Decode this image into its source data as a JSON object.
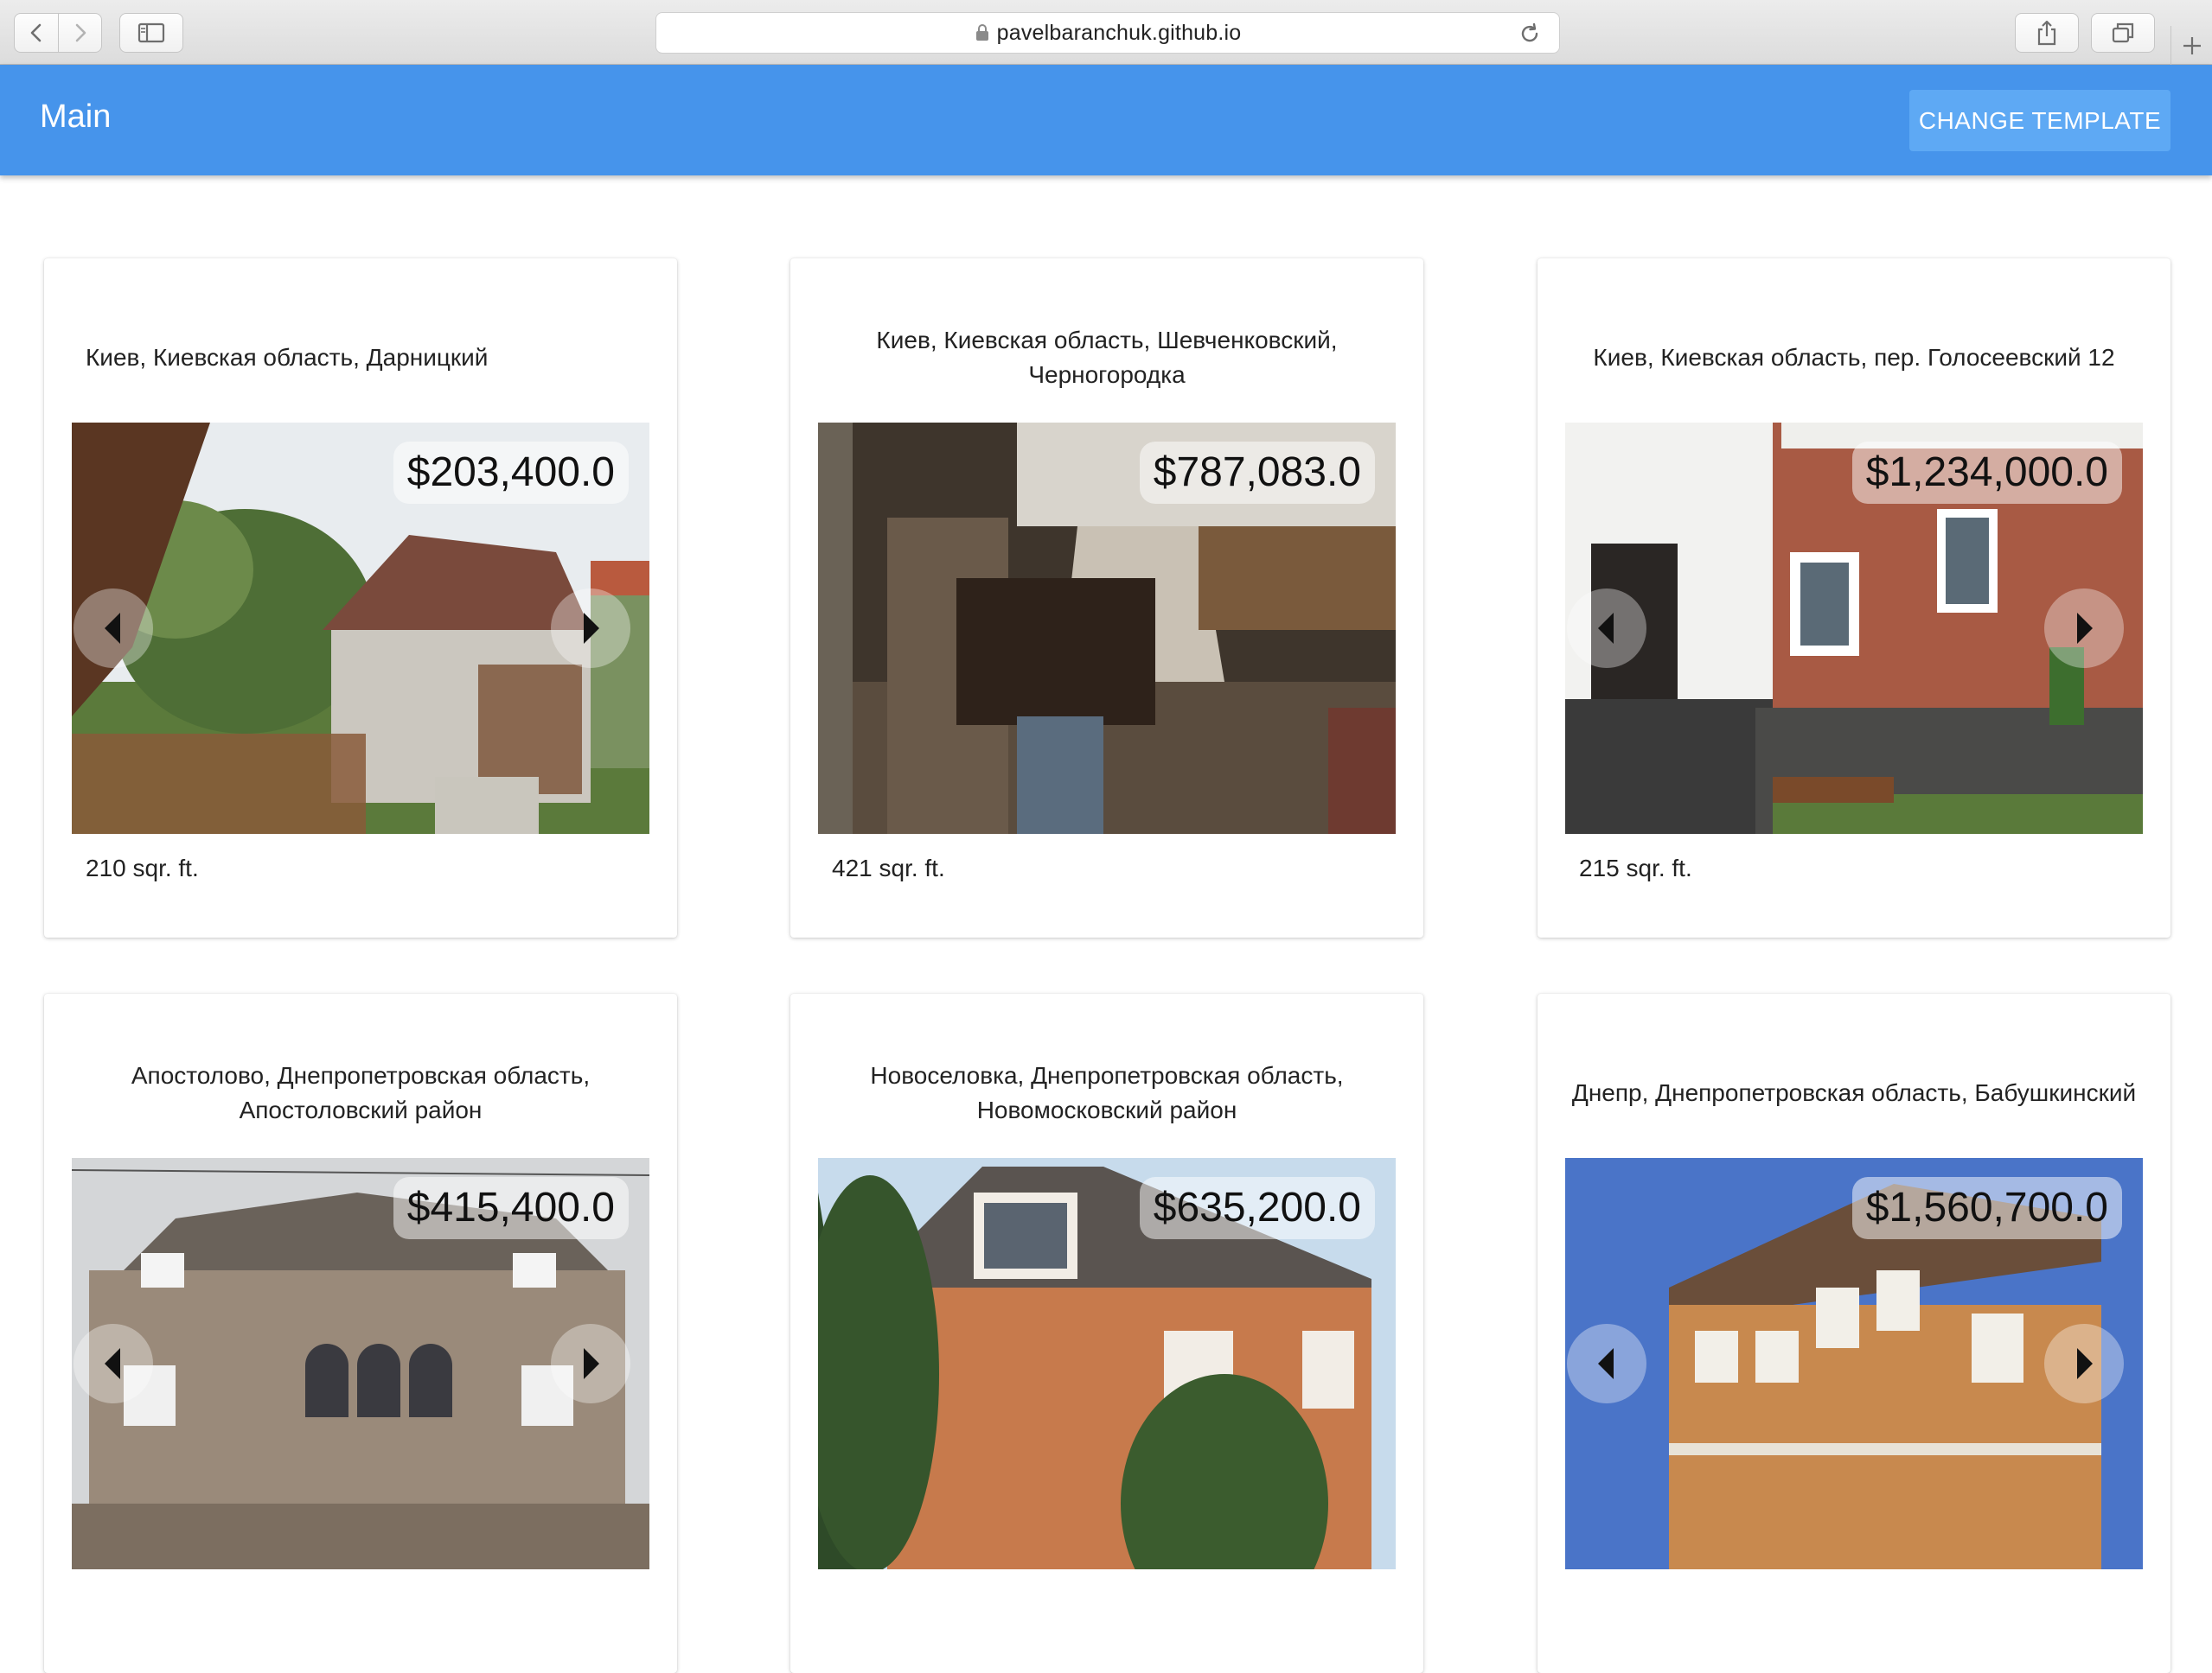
{
  "browser": {
    "url": "pavelbaranchuk.github.io"
  },
  "appbar": {
    "title": "Main",
    "change_template_label": "CHANGE TEMPLATE",
    "color": "#4694eb"
  },
  "listings": [
    {
      "address": "Киев, Киевская область, Дарницкий",
      "price": "$203,400.0",
      "area": "210 sqr. ft.",
      "scene": "garden-house"
    },
    {
      "address": "Киев, Киевская область, Шевченковский, Черногородка",
      "price": "$787,083.0",
      "area": "421 sqr. ft.",
      "scene": "interior-room"
    },
    {
      "address": "Киев, Киевская область, пер. Голосеевский 12",
      "price": "$1,234,000.0",
      "area": "215 sqr. ft.",
      "scene": "brick-facade"
    },
    {
      "address": "Апостолово, Днепропетровская область, Апостоловский район",
      "price": "$415,400.0",
      "area": "",
      "scene": "stone-mansion"
    },
    {
      "address": "Новоселовка, Днепропетровская область, Новомосковский район",
      "price": "$635,200.0",
      "area": "",
      "scene": "brick-house-pines"
    },
    {
      "address": "Днепр, Днепропетровская область, Бабушкинский",
      "price": "$1,560,700.0",
      "area": "",
      "scene": "tall-house"
    }
  ]
}
